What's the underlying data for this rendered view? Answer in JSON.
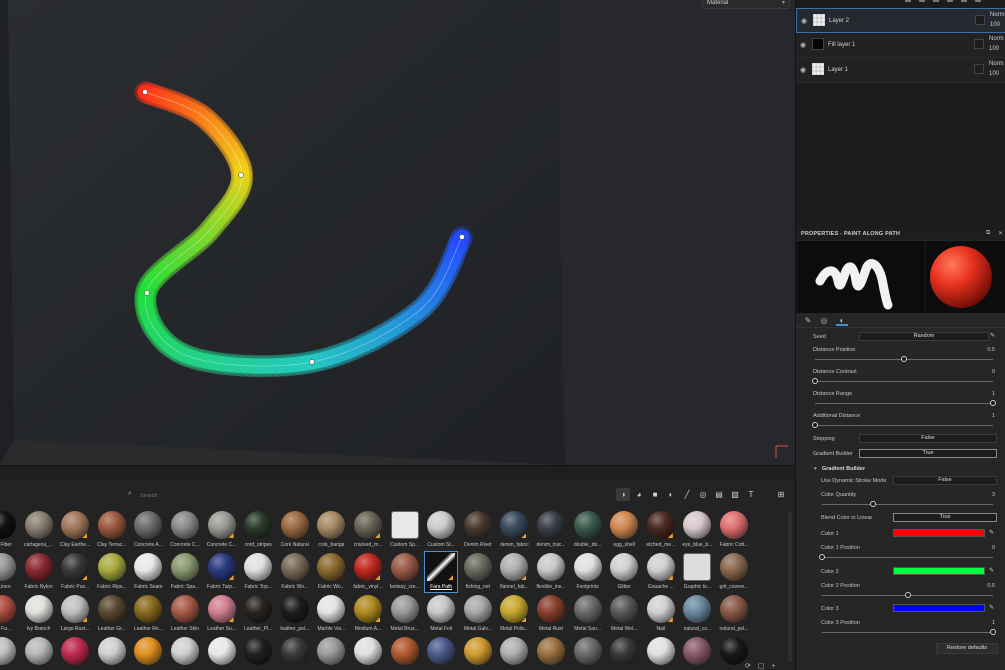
{
  "viewport": {
    "material_dropdown": "Material",
    "stroke_colors": [
      "#ff2a1a",
      "#f2d11a",
      "#22dd3a",
      "#24c9c0",
      "#2448ff"
    ]
  },
  "layers": [
    {
      "name": "Layer 2",
      "blend": "Norm",
      "opacity": "100",
      "thumb": "checker",
      "selected": true
    },
    {
      "name": "Fill layer 1",
      "blend": "Norm",
      "opacity": "100",
      "thumb": "black",
      "selected": false
    },
    {
      "name": "Layer 1",
      "blend": "Norm",
      "opacity": "100",
      "thumb": "checker",
      "selected": false
    }
  ],
  "properties": {
    "title": "PROPERTIES - PAINT ALONG PATH",
    "header_icons": [
      "pin-icon",
      "close-icon"
    ],
    "tabs": [
      "brush-icon",
      "material-icon",
      "path-icon"
    ],
    "seed_label": "Seed",
    "seed_value": "Random",
    "distance_position": {
      "label": "Distance Position",
      "value": "0.5",
      "fraction": 0.5
    },
    "distance_contrast": {
      "label": "Distance Contrast",
      "value": "0",
      "fraction": 0
    },
    "distance_range": {
      "label": "Distance Range",
      "value": "1",
      "fraction": 1
    },
    "additional_distance": {
      "label": "Additional Distance",
      "value": "1",
      "fraction": 0
    },
    "stepping": {
      "label": "Stepping",
      "value": "False"
    },
    "gradient_builder": {
      "label": "Gradient Builder",
      "value": "True"
    },
    "gradient_section": "Gradient Builder",
    "use_dynamic": {
      "label": "Use Dynamic Stroke Mode",
      "value": "False"
    },
    "color_quantity": {
      "label": "Color Quantity",
      "value": "3",
      "fraction": 0.3
    },
    "blend_linear": {
      "label": "Blend Color in Linear",
      "value": "True"
    },
    "color1": {
      "label": "Color 1",
      "color": "#ff0000"
    },
    "color1_pos": {
      "label": "Color 1 Position",
      "value": "0",
      "fraction": 0
    },
    "color2": {
      "label": "Color 2",
      "color": "#00ff3c"
    },
    "color2_pos": {
      "label": "Color 2 Position",
      "value": "0.5",
      "fraction": 0.5
    },
    "color3": {
      "label": "Color 3",
      "color": "#0000ff"
    },
    "color3_pos": {
      "label": "Color 3 Position",
      "value": "1",
      "fraction": 1
    },
    "restore": "Restore defaults"
  },
  "shelf": {
    "search_placeholder": "Search",
    "filter_icons": [
      "material-filter-icon",
      "smart-material-icon",
      "mask-icon",
      "filter-icon",
      "brush-icon",
      "particle-icon",
      "texture-icon",
      "environment-icon",
      "text-icon"
    ],
    "grid_icon": "grid-view-icon",
    "rows": [
      [
        {
          "label": "ton Fiber",
          "color": "#111111"
        },
        {
          "label": "cartagena_...",
          "color": "#8a7f72"
        },
        {
          "label": "Clay Earthe...",
          "color": "#a0785a"
        },
        {
          "label": "Clay Terrac...",
          "color": "#9a5a40"
        },
        {
          "label": "Concrete A...",
          "color": "#6c6c6c"
        },
        {
          "label": "Concrete C...",
          "color": "#8a8a88"
        },
        {
          "label": "Concrete C...",
          "color": "#9a9a96"
        },
        {
          "label": "cord_stripes",
          "color": "#2a3a2a"
        },
        {
          "label": "Cork Natural",
          "color": "#9a6a44"
        },
        {
          "label": "cork_bariga",
          "color": "#a88a66"
        },
        {
          "label": "cracked_m...",
          "color": "#6a6456"
        },
        {
          "label": "Custom Sp...",
          "color": "#e8e8e8",
          "square": true
        },
        {
          "label": "Custom St...",
          "color": "#cccccc",
          "smiley": true
        },
        {
          "label": "Denim Rivet",
          "color": "#4a3a30"
        },
        {
          "label": "denim_fabric",
          "color": "#3a4a5c"
        },
        {
          "label": "denim_trac...",
          "color": "#3a3f48"
        },
        {
          "label": "double_rib...",
          "color": "#3a5a4c"
        },
        {
          "label": "egg_shell",
          "color": "#d08850"
        },
        {
          "label": "etched_me...",
          "color": "#4a2a22"
        },
        {
          "label": "eye_blue_b...",
          "color": "#d8c8cc"
        },
        {
          "label": "Fabric Cott...",
          "color": "#e07070"
        }
      ],
      [
        {
          "label": "ic Linen",
          "color": "#9a9898"
        },
        {
          "label": "Fabric Nylon",
          "color": "#8a2a30"
        },
        {
          "label": "Fabric Pus...",
          "color": "#3a3a3a"
        },
        {
          "label": "Fabric Rips...",
          "color": "#a8aa40"
        },
        {
          "label": "Fabric Seam",
          "color": "#e8e8e6"
        },
        {
          "label": "Fabric Spa...",
          "color": "#8a9a70"
        },
        {
          "label": "Fabric Tarp...",
          "color": "#2a3a80"
        },
        {
          "label": "Fabric Top...",
          "color": "#e0e0e0"
        },
        {
          "label": "Fabric Wo...",
          "color": "#7a6a58"
        },
        {
          "label": "Fabric Wo...",
          "color": "#8a6a30"
        },
        {
          "label": "fabric_vinyl...",
          "color": "#c02a20"
        },
        {
          "label": "fantasy_cre...",
          "color": "#9a5a48"
        },
        {
          "label": "Fara Path",
          "color": "#ffffff",
          "selected": true
        },
        {
          "label": "fishing_net",
          "color": "#6a6a60"
        },
        {
          "label": "flannel_fab...",
          "color": "#b0b0b0"
        },
        {
          "label": "flexible_ins...",
          "color": "#c8c8c8"
        },
        {
          "label": "Footprints",
          "color": "#e0e0e0"
        },
        {
          "label": "Glitter",
          "color": "#d0d0d0"
        },
        {
          "label": "Gouache ...",
          "color": "#cfcfcf"
        },
        {
          "label": "Graphic to...",
          "color": "#dddddd",
          "square": true
        },
        {
          "label": "grit_covere...",
          "color": "#8a6a50"
        }
      ],
      [
        {
          "label": "am Fa...",
          "color": "#b05040"
        },
        {
          "label": "Ivy Branch",
          "color": "#e0e0dc"
        },
        {
          "label": "Large Rust...",
          "color": "#c0c0c0"
        },
        {
          "label": "Leather Gr...",
          "color": "#5a4a30"
        },
        {
          "label": "Leather Re...",
          "color": "#8a6a20"
        },
        {
          "label": "Leather Skin",
          "color": "#a85a48"
        },
        {
          "label": "Leather Su...",
          "color": "#d08090"
        },
        {
          "label": "Leather_Pl...",
          "color": "#2a2420"
        },
        {
          "label": "leather_pol...",
          "color": "#1e1e1e"
        },
        {
          "label": "Marble Vei...",
          "color": "#e4e4e2"
        },
        {
          "label": "Medium A...",
          "color": "#b08a20"
        },
        {
          "label": "Metal Brus...",
          "color": "#9a9a9a"
        },
        {
          "label": "Metal Foil",
          "color": "#c8c8c8"
        },
        {
          "label": "Metal Galv...",
          "color": "#a8a8a8"
        },
        {
          "label": "Metal Polis...",
          "color": "#c8a830"
        },
        {
          "label": "Metal Rust",
          "color": "#8a4030"
        },
        {
          "label": "Metal San...",
          "color": "#6a6a6a"
        },
        {
          "label": "Metal Wel...",
          "color": "#5a5a5a"
        },
        {
          "label": "Nail",
          "color": "#d0d0d0"
        },
        {
          "label": "natural_co...",
          "color": "#6a8aa0"
        },
        {
          "label": "natural_pel...",
          "color": "#8a5a48"
        }
      ],
      [
        {
          "label": "",
          "color": "#c0c0c0"
        },
        {
          "label": "",
          "color": "#b8b8b8"
        },
        {
          "label": "",
          "color": "#c02a50"
        },
        {
          "label": "",
          "color": "#d0d0d0"
        },
        {
          "label": "",
          "color": "#e09020"
        },
        {
          "label": "",
          "color": "#d0d0d0"
        },
        {
          "label": "",
          "color": "#e8e8e8"
        },
        {
          "label": "",
          "color": "#202020"
        },
        {
          "label": "",
          "color": "#3a3a3a"
        },
        {
          "label": "",
          "color": "#9a9a98"
        },
        {
          "label": "",
          "color": "#e0e0e0"
        },
        {
          "label": "",
          "color": "#b05a30"
        },
        {
          "label": "",
          "color": "#4a5a8a"
        },
        {
          "label": "",
          "color": "#d09a30"
        },
        {
          "label": "",
          "color": "#b0b0b0"
        },
        {
          "label": "",
          "color": "#9a7040"
        },
        {
          "label": "",
          "color": "#6a6a6a"
        },
        {
          "label": "",
          "color": "#3a3a3a"
        },
        {
          "label": "",
          "color": "#e0e0e0"
        },
        {
          "label": "",
          "color": "#8a5a6a"
        },
        {
          "label": "",
          "color": "#1a1a1a"
        }
      ]
    ]
  }
}
